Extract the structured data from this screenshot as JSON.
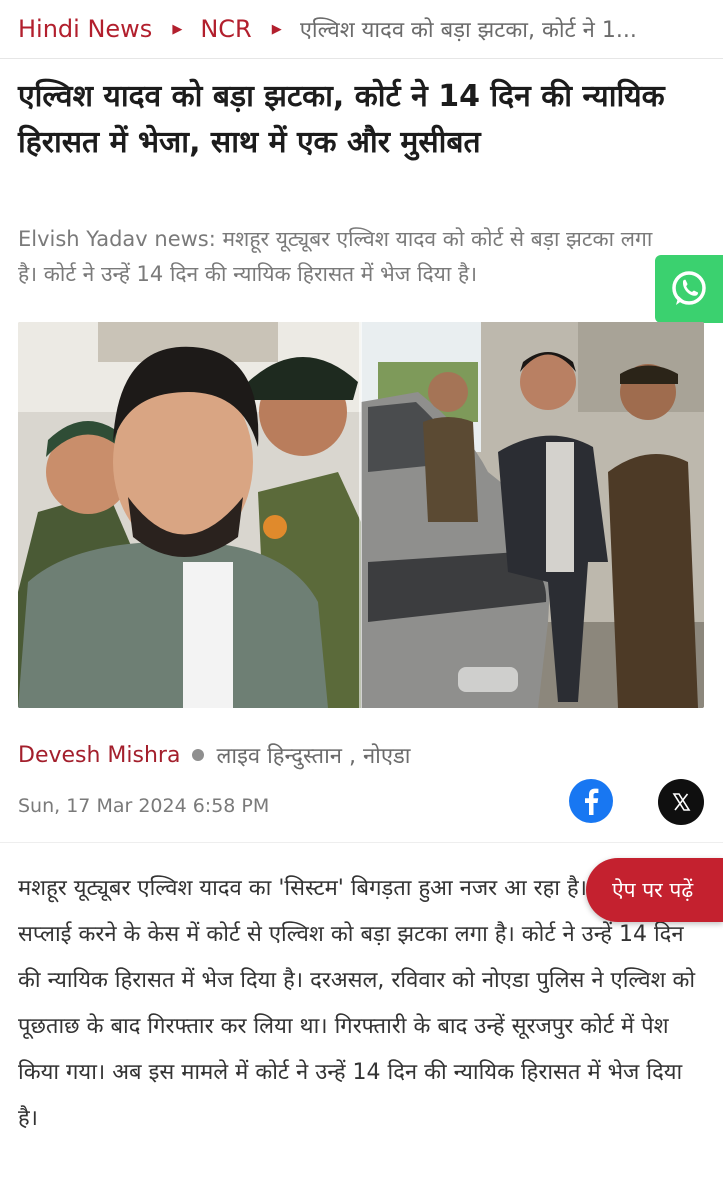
{
  "breadcrumb": {
    "home": "Hindi News",
    "section": "NCR",
    "current": "एल्विश यादव को बड़ा झटका, कोर्ट ने 1..."
  },
  "article": {
    "headline": "एल्विश यादव को बड़ा झटका, कोर्ट ने 14 दिन की न्यायिक हिरासत में भेजा, साथ में एक और मुसीबत",
    "summary": "Elvish Yadav news: मशहूर यूट्यूबर एल्विश यादव को कोर्ट से बड़ा झटका लगा है। कोर्ट ने उन्हें 14 दिन की न्यायिक हिरासत में भेज दिया है।",
    "author": "Devesh Mishra",
    "source": "लाइव हिन्दुस्तान , नोएडा",
    "date": "Sun, 17 Mar 2024 6:58 PM",
    "body": "मशहूर यूट्यूबर एल्विश यादव का 'सिस्टम' बिगड़ता हुआ नजर आ रहा है। सांपों का जहर सप्लाई करने के केस में कोर्ट से एल्विश को बड़ा झटका लगा है। कोर्ट ने उन्हें 14 दिन की न्यायिक हिरासत में भेज दिया है। दरअसल, रविवार को नोएडा पुलिस ने एल्विश को पूछताछ के बाद गिरफ्तार कर लिया था। गिरफ्तारी के बाद उन्हें सूरजपुर कोर्ट में पेश किया गया। अब इस मामले में कोर्ट ने उन्हें 14 दिन की न्यायिक हिरासत में भेज दिया है।"
  },
  "share": {
    "facebook_icon": "facebook-icon",
    "x_icon": "x-icon",
    "whatsapp_icon": "whatsapp-icon"
  },
  "cta": {
    "app_label": "ऐप पर पढ़ें"
  },
  "colors": {
    "brand_red": "#b21f2d",
    "whatsapp_green": "#3bd16f",
    "facebook_blue": "#1877f2"
  }
}
